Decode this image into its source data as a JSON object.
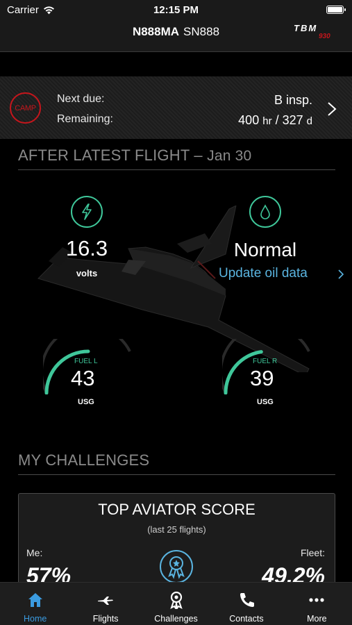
{
  "status_bar": {
    "carrier": "Carrier",
    "time": "12:15 PM"
  },
  "header": {
    "registration": "N888MA",
    "serial": "SN888",
    "logo_text": "TBM",
    "logo_model": "930"
  },
  "maintenance": {
    "badge": "CAMP",
    "next_due_label": "Next due:",
    "next_due_value": "B insp.",
    "remaining_label": "Remaining:",
    "remaining_hours": "400",
    "remaining_hours_unit": "hr",
    "remaining_separator": " / ",
    "remaining_days": "327",
    "remaining_days_unit": "d"
  },
  "latest_flight": {
    "title": "AFTER LATEST FLIGHT",
    "separator": " – ",
    "date": "Jan 30",
    "battery": {
      "value": "16.3",
      "unit": "volts"
    },
    "oil": {
      "status": "Normal",
      "link": "Update oil data"
    },
    "fuel_left": {
      "label": "FUEL L",
      "value": "43",
      "unit": "USG",
      "level": 0.43
    },
    "fuel_right": {
      "label": "FUEL R",
      "value": "39",
      "unit": "USG",
      "level": 0.39
    }
  },
  "challenges": {
    "title": "MY CHALLENGES",
    "card": {
      "title": "TOP AVIATOR SCORE",
      "subtitle": "(last 25 flights)",
      "me_label": "Me:",
      "me_value": "57%",
      "fleet_label": "Fleet:",
      "fleet_value": "49.2%"
    }
  },
  "tab_bar": {
    "items": [
      {
        "label": "Home",
        "icon": "home-icon",
        "active": true
      },
      {
        "label": "Flights",
        "icon": "plane-icon",
        "active": false
      },
      {
        "label": "Challenges",
        "icon": "medal-icon",
        "active": false
      },
      {
        "label": "Contacts",
        "icon": "phone-icon",
        "active": false
      },
      {
        "label": "More",
        "icon": "more-icon",
        "active": false
      }
    ]
  },
  "colors": {
    "accent_green": "#3fc79a",
    "link_blue": "#5ab4e0",
    "tab_active": "#3b9be0",
    "camp_red": "#c4161c"
  }
}
